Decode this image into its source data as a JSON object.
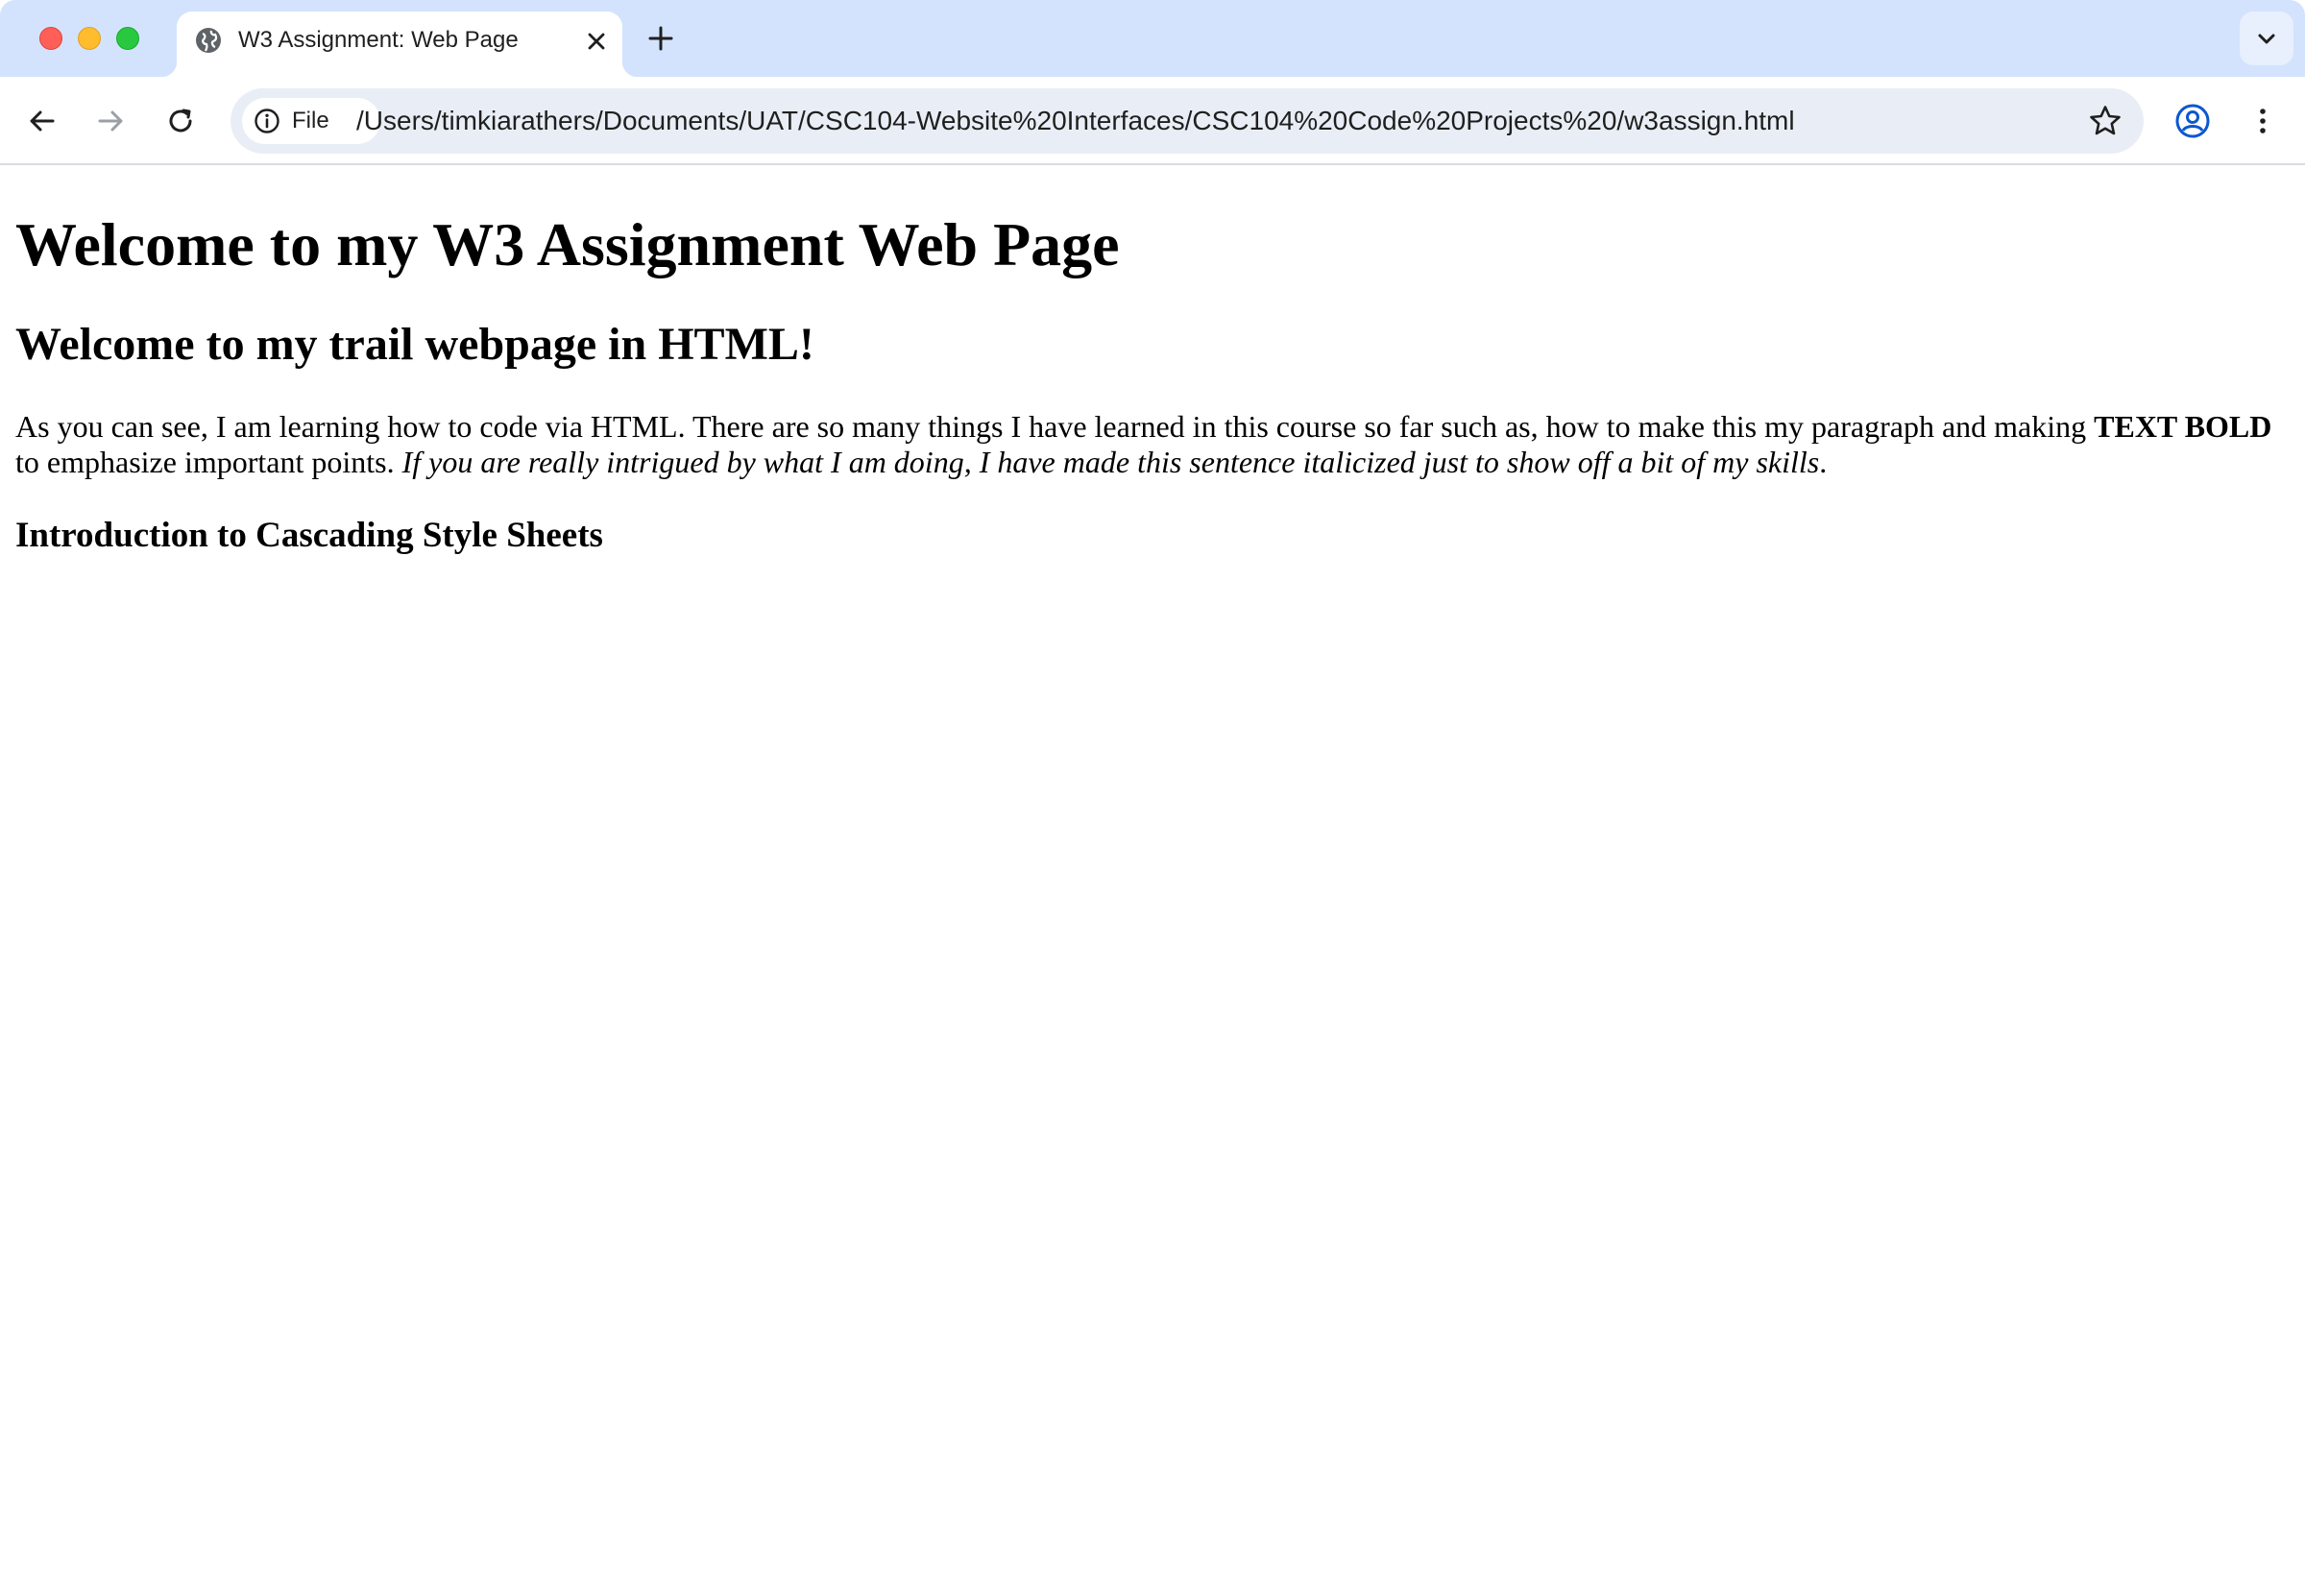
{
  "browser": {
    "tab": {
      "title": "W3 Assignment: Web Page",
      "favicon": "globe-icon"
    },
    "address_bar": {
      "scheme_chip": "File",
      "url": "/Users/timkiarathers/Documents/UAT/CSC104-Website%20Interfaces/CSC104%20Code%20Projects%20/w3assign.html"
    },
    "icons": {
      "back": "arrow-left-icon",
      "forward": "arrow-right-icon",
      "reload": "reload-icon",
      "bookmark": "star-icon",
      "profile": "profile-icon",
      "menu": "kebab-menu-icon",
      "new_tab": "plus-icon",
      "tab_search": "chevron-down-icon",
      "close_tab": "close-icon",
      "site_info": "info-icon"
    },
    "colors": {
      "tabstrip": "#d3e3fd",
      "omnibox": "#e9eef6",
      "profile_accent": "#0b57d0"
    }
  },
  "page": {
    "heading1": "Welcome to my W3 Assignment Web Page",
    "heading2": "Welcome to my trail webpage in HTML!",
    "paragraph": {
      "text_before_bold": "As you can see, I am learning how to code via HTML. There are so many things I have learned in this course so far such as, how to make this my paragraph and making ",
      "bold_text": "TEXT BOLD",
      "text_after_bold": " to emphasize important points. ",
      "italic_text": "If you are really intrigued by what I am doing, I have made this sentence italicized just to show off a bit of my skills",
      "ending": "."
    },
    "heading3": "Introduction to Cascading Style Sheets"
  }
}
